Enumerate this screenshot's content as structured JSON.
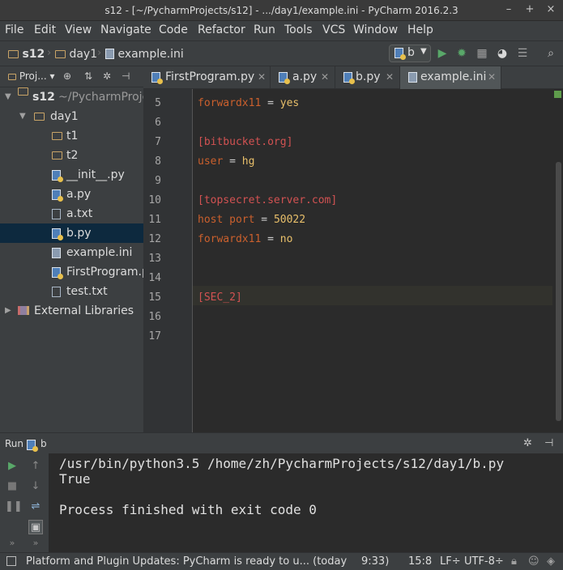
{
  "window": {
    "title": "s12 - [~/PycharmProjects/s12] - .../day1/example.ini - PyCharm 2016.2.3",
    "min": "–",
    "max": "+",
    "close": "×"
  },
  "menu": [
    "File",
    "Edit",
    "View",
    "Navigate",
    "Code",
    "Refactor",
    "Run",
    "Tools",
    "VCS",
    "Window",
    "Help"
  ],
  "breadcrumb": [
    "s12",
    "day1",
    "example.ini"
  ],
  "run_config": "b",
  "project_panel": {
    "label": "Proj..."
  },
  "tree": {
    "root": "s12",
    "root_path": "~/PycharmProje",
    "items": [
      "day1",
      "t1",
      "t2",
      "__init__.py",
      "a.py",
      "a.txt",
      "b.py",
      "example.ini",
      "FirstProgram.p",
      "test.txt"
    ],
    "external": "External Libraries"
  },
  "tabs": [
    "FirstProgram.py",
    "a.py",
    "b.py",
    "example.ini"
  ],
  "editor": {
    "line_numbers": [
      "5",
      "6",
      "7",
      "8",
      "9",
      "10",
      "11",
      "12",
      "13",
      "14",
      "15",
      "16",
      "17"
    ],
    "lines": {
      "l5_key": "forwardx11",
      "l5_eq": " = ",
      "l5_val": "yes",
      "l7_sec": "[bitbucket.org]",
      "l8_key": "user",
      "l8_eq": " = ",
      "l8_val": "hg",
      "l10_sec": "[topsecret.server.com]",
      "l11_key": "host port",
      "l11_eq": " = ",
      "l11_val": "50022",
      "l12_key": "forwardx11",
      "l12_eq": " = ",
      "l12_val": "no",
      "l15_sec": "[SEC_2]"
    }
  },
  "run": {
    "label": "Run",
    "config": "b",
    "output": [
      "/usr/bin/python3.5 /home/zh/PycharmProjects/s12/day1/b.py",
      "True",
      "",
      "Process finished with exit code 0"
    ]
  },
  "status": {
    "message": "Platform and Plugin Updates: PyCharm is ready to u... (today",
    "time": "9:33)",
    "position": "15:8",
    "line_sep": "LF÷",
    "encoding": "UTF-8÷"
  }
}
